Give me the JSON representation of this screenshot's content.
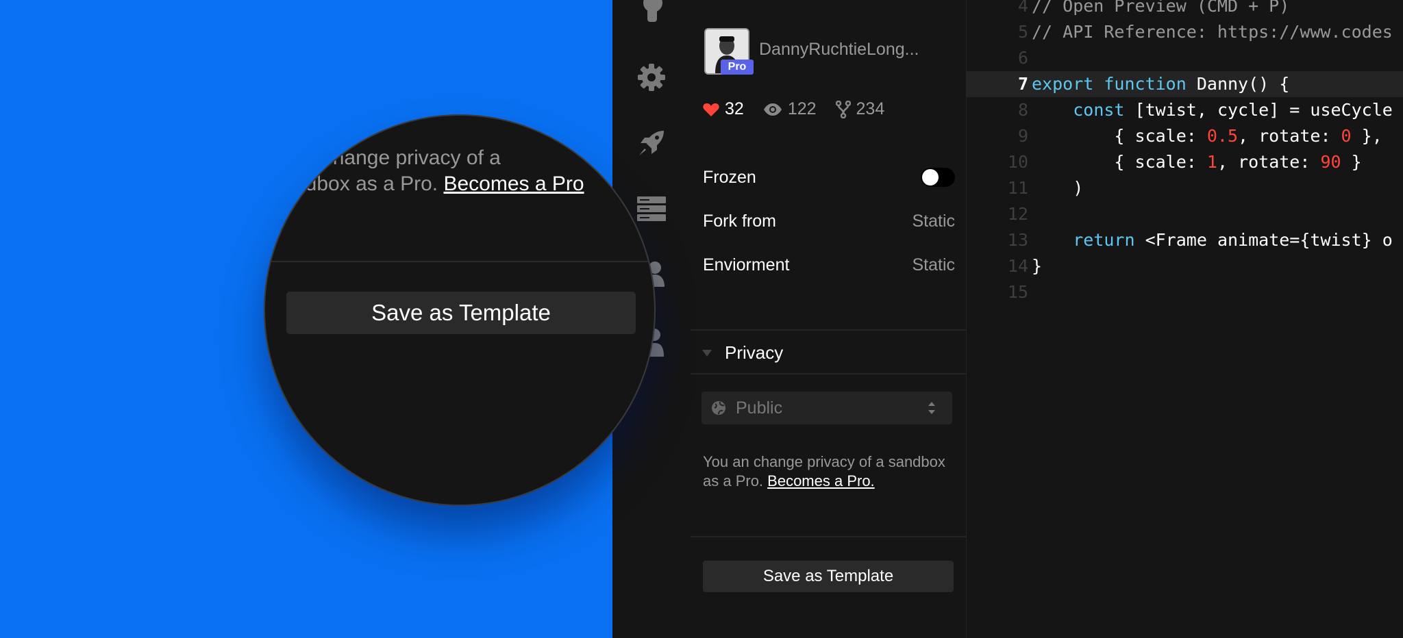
{
  "profile": {
    "username": "DannyRuchtieLong...",
    "badge": "Pro"
  },
  "stats": {
    "likes": "32",
    "views": "122",
    "forks": "234"
  },
  "settings": [
    {
      "label": "Frozen"
    },
    {
      "label": "Fork from",
      "value": "Static"
    },
    {
      "label": "Enviorment",
      "value": "Static"
    }
  ],
  "privacy": {
    "heading": "Privacy",
    "select_value": "Public",
    "note_text": "You an change privacy of a sandbox as a Pro. ",
    "note_link": "Becomes a Pro."
  },
  "magnifier": {
    "note_line1": "an change privacy of a",
    "note_line2": "ndbox as a Pro. ",
    "note_link": "Becomes a Pro",
    "button": "Save as Template"
  },
  "save_button": "Save as Template",
  "editor": {
    "active_line": "7",
    "lines": [
      {
        "n": "4",
        "t": "// Open Preview (CMD + P)"
      },
      {
        "n": "5",
        "t": "// API Reference: https://www.codes"
      },
      {
        "n": "6",
        "t": ""
      },
      {
        "n": "7",
        "t": "export function Danny() {"
      },
      {
        "n": "8",
        "t": "    const [twist, cycle] = useCycle"
      },
      {
        "n": "9",
        "t": "        { scale: 0.5, rotate: 0 },"
      },
      {
        "n": "10",
        "t": "        { scale: 1, rotate: 90 }"
      },
      {
        "n": "11",
        "t": "    )"
      },
      {
        "n": "12",
        "t": ""
      },
      {
        "n": "13",
        "t": "    return <Frame animate={twist} o"
      },
      {
        "n": "14",
        "t": "}"
      },
      {
        "n": "15",
        "t": ""
      }
    ]
  },
  "colors": {
    "accent_blue": "#0971f1",
    "pro_badge": "#5a63e8",
    "heart": "#ff453a",
    "keyword": "#5cc8f2",
    "number": "#ff453a"
  },
  "icons": [
    "user-icon",
    "gear-icon",
    "rocket-icon",
    "server-icon",
    "users-icon",
    "person-icon",
    "heart-icon",
    "eye-icon",
    "fork-icon",
    "caret-down-icon",
    "globe-icon",
    "select-arrows-icon"
  ]
}
